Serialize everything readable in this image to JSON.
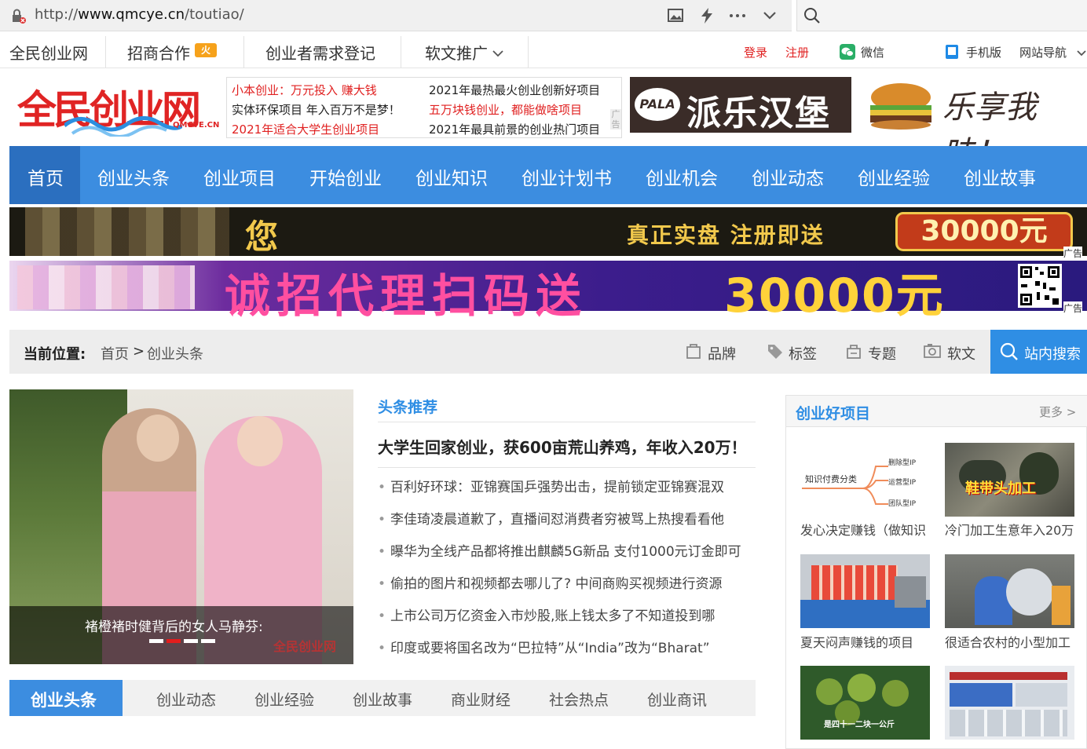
{
  "browser": {
    "url_prefix": "http://",
    "url_domain": "www.qmcye.cn",
    "url_path": "/toutiao/"
  },
  "topnav": {
    "site_name": "全民创业网",
    "items": [
      "招商合作",
      "创业者需求登记",
      "软文推广"
    ],
    "login": "登录",
    "register": "注册",
    "wechat": "微信",
    "mobile": "手机版",
    "sitemap": "网站导航"
  },
  "logo": {
    "text": "全民创业网",
    "sub": "QMCYE.CN"
  },
  "text_ads": [
    [
      "小本创业：万元投入 赚大钱",
      "2021年最热最火创业创新好项目"
    ],
    [
      "实体环保项目 年入百万不是梦！",
      "五万块钱创业，都能做啥项目"
    ],
    [
      "2021年适合大学生创业项目",
      "2021年最具前景的创业热门项目"
    ]
  ],
  "ad_label": "广告",
  "pala": {
    "logo": "PALA",
    "name": "派乐汉堡"
  },
  "burger_slogan": "乐享我味！",
  "mainnav": [
    "首页",
    "创业头条",
    "创业项目",
    "开始创业",
    "创业知识",
    "创业计划书",
    "创业机会",
    "创业动态",
    "创业经验",
    "创业故事"
  ],
  "banner1": {
    "left": "您",
    "right": "真正实盘 注册即送",
    "amount": "30000元"
  },
  "banner2": {
    "text": "诚招代理扫码送",
    "amount": "30000元"
  },
  "breadcrumb": {
    "label": "当前位置:",
    "home": "首页",
    "sep": ">",
    "current": "创业头条",
    "links": [
      "品牌",
      "标签",
      "专题",
      "软文"
    ],
    "search": "站内搜索"
  },
  "hero": {
    "caption": "褚橙褚时健背后的女人马静芬:",
    "watermark": "全民创业网"
  },
  "recommend": {
    "title": "头条推荐",
    "headline": "大学生回家创业，获600亩荒山养鸡，年收入20万！",
    "items": [
      "百利好环球：亚锦赛国乒强势出击，提前锁定亚锦赛混双",
      "李佳琦凌晨道歉了，直播间怼消费者穷被骂上热搜看看他",
      "曝华为全线产品都将推出麒麟5G新品 支付1000元订金即可",
      "偷拍的图片和视频都去哪儿了? 中间商购买视频进行资源",
      "上市公司万亿资金入市炒股,账上钱太多了不知道投到哪",
      "印度或要将国名改为“巴拉特”从“India”改为“Bharat”"
    ]
  },
  "good_projects": {
    "title": "创业好项目",
    "more": "更多 >",
    "items": [
      {
        "title": "发心决定赚钱（做知识",
        "img_text": "知识付费分类"
      },
      {
        "title": "冷门加工生意年入20万",
        "img_text": "鞋带头加工"
      },
      {
        "title": "夏天闷声赚钱的项目",
        "img_text": ""
      },
      {
        "title": "很适合农村的小型加工",
        "img_text": ""
      },
      {
        "title": "",
        "img_text": "是四十一二块一公斤"
      },
      {
        "title": "",
        "img_text": ""
      }
    ],
    "mindmap_labels": [
      "删除型IP",
      "运营型IP",
      "团队型IP"
    ]
  },
  "tabs": [
    "创业头条",
    "创业动态",
    "创业经验",
    "创业故事",
    "商业财经",
    "社会热点",
    "创业商讯"
  ]
}
